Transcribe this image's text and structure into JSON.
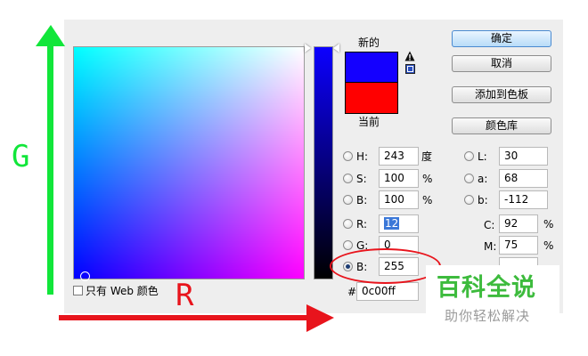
{
  "dialog": {
    "new_label": "新的",
    "current_label": "当前",
    "new_color": "#1400ff",
    "current_color": "#ff0000",
    "web_only_label": "只有 Web 颜色",
    "hex_prefix": "#",
    "hex_value": "0c00ff"
  },
  "buttons": {
    "ok": "确定",
    "cancel": "取消",
    "add_swatch": "添加到色板",
    "libraries": "颜色库"
  },
  "hsb": {
    "h_label": "H:",
    "h_value": "243",
    "h_unit": "度",
    "s_label": "S:",
    "s_value": "100",
    "s_unit": "%",
    "b_label": "B:",
    "b_value": "100",
    "b_unit": "%"
  },
  "rgb": {
    "r_label": "R:",
    "r_value": "12",
    "g_label": "G:",
    "g_value": "0",
    "b_label": "B:",
    "b_value": "255"
  },
  "lab": {
    "l_label": "L:",
    "l_value": "30",
    "a_label": "a:",
    "a_value": "68",
    "b_label": "b:",
    "b_value": "-112"
  },
  "cmyk": {
    "c_label": "C:",
    "c_value": "92",
    "c_unit": "%",
    "m_label": "M:",
    "m_value": "75",
    "m_unit": "%"
  },
  "annotations": {
    "g_axis": "G",
    "r_axis": "R",
    "green": "#11e63a",
    "red": "#e8141c"
  },
  "watermark": {
    "title": "百科全说",
    "subtitle": "助你轻松解决"
  }
}
